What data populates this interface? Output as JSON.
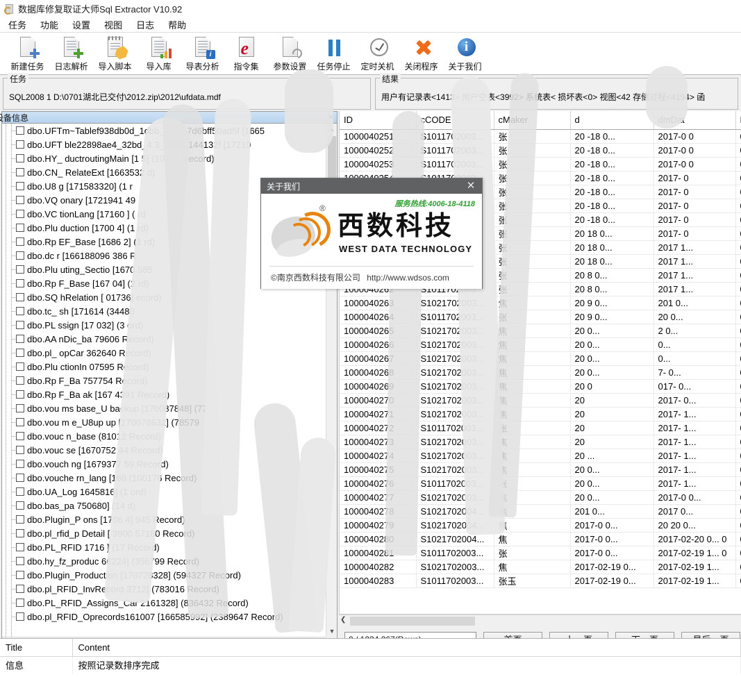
{
  "window": {
    "title": "数据库修复取证大师Sql Extractor V10.92",
    "app_icon": "database-repair-icon"
  },
  "menu": {
    "items": [
      "任务",
      "功能",
      "设置",
      "视图",
      "日志",
      "帮助"
    ]
  },
  "toolbar": {
    "buttons": [
      {
        "label": "新建任务",
        "icon": "new-task-icon"
      },
      {
        "label": "日志解析",
        "icon": "log-parse-icon"
      },
      {
        "label": "导入脚本",
        "icon": "import-script-icon"
      },
      {
        "label": "导入库",
        "icon": "import-db-icon"
      },
      {
        "label": "导表分析",
        "icon": "export-analysis-icon"
      },
      {
        "label": "指令集",
        "icon": "command-set-icon"
      },
      {
        "label": "参数设置",
        "icon": "parameter-settings-icon"
      },
      {
        "label": "任务停止",
        "icon": "stop-task-icon"
      },
      {
        "label": "定时关机",
        "icon": "scheduled-shutdown-icon"
      },
      {
        "label": "关闭程序",
        "icon": "close-program-icon"
      },
      {
        "label": "关于我们",
        "icon": "about-us-icon"
      }
    ]
  },
  "task_group": {
    "caption": "任务",
    "value": "SQL2008 1 D:\\0701湖北已交付\\2012.zip\\2012\\ufdata.mdf"
  },
  "result_group": {
    "caption": "结果",
    "value": "用户有记录表<1413>  用户空表<3992>  系统表<        损坏表<0>  视图<42        存储过程<4194>  函"
  },
  "left_pane": {
    "tab_label": "设备信息",
    "close_label": "×",
    "rows": [
      "dbo.UFTm~Tablef938db0d_1dbb_4                 20_7d6bff50ad5f [1665",
      "dbo.UFT        ble22898ae4_32bd_4         3_30011144132f [17210",
      "dbo.HY_        ductroutingMain [1        5] (10781 Record)",
      "dbo.CN_        RelateExt [1663532                  d)",
      "dbo.U8         g [171583320] (1                   r",
      "dbo.VQ         onary [1721941         49",
      "dbo.VC         tionLang [17160       ] (             rd",
      "dbo.Plu        duction [1700         4] (1          rd)",
      "dbo.Rp         EF_Base [1686         2] (1         rd)",
      "dbo.dc         r [166188096          386 R",
      "dbo.Plu        uting_Sectio       [1670          585",
      "dbo.Rp         F_Base [167        04] (2         rd)",
      "dbo.SQ         hRelation [       01736]         ecord)",
      "dbo.tc_        sh [171614         (34480",
      "dbo.PL         ssign [17         032] (3         ord)",
      "dbo.AA         nDic_ba          79606            Record)",
      "dbo.pl_        opCar          362640           Record)",
      "dbo.Plu        ctionIn         07595            Record)",
      "dbo.Rp         F_Ba          757754           Record)",
      "dbo.Rp         F_Ba      ak [167          4391 Record)",
      "dbo.vou        ms       base_U           backup [170087848] (77",
      "dbo.vou        m        e_U8up             up [170078632] (78579",
      "dbo.vouc               n_base               (81012 Record)",
      "dbo.vouc       se [1670752              44 Record)",
      "dbo.vouch              ng [1679377             59 Record)",
      "dbo.vouche             rn_lang [168            (100176 Record)",
      "dbo.UA_Log          1645816] (1             ord)",
      "dbo.bas_pa         750680] (14            d)",
      "dbo.Plugin_P         ons [1706        4]        945 Record)",
      "dbo.pl_rfid_p          Detail [       3900      57180 Record)",
      "dbo.PL_RFID            1716        ] (17      Record)",
      "dbo.hy_fz_produc              66224] (356799 Record)",
      "dbo.Plugin_Production          [170728328] (594327 Record)",
      "dbo.pl_RFID_InvRecord         3712] (783016 Record)",
      "dbo.PL_RFID_Assigns_Car      2161328] (836432 Record)",
      "dbo.pl_RFID_Oprecords161007 [166585992] (2389647 Record)"
    ]
  },
  "grid": {
    "columns": [
      "ID",
      "cCODE",
      "cMaker",
      "d",
      "dmDat",
      "FromType"
    ],
    "rows": [
      [
        "1000040251",
        "S1011702003...",
        "张",
        "20",
        "-18 0...",
        "2017-0",
        "0"
      ],
      [
        "1000040252",
        "S1011702003...",
        "张",
        "20",
        "-18 0...",
        "2017-0",
        "0"
      ],
      [
        "1000040253",
        "S1011702003...",
        "张",
        "20",
        "-18 0...",
        "2017-0",
        "0"
      ],
      [
        "1000040254",
        "S1011702003...",
        "张",
        "20",
        "-18 0...",
        "2017-",
        "0"
      ],
      [
        "1000040255",
        "S1011702003...",
        "张",
        "20",
        "-18 0...",
        "2017-",
        "0"
      ],
      [
        "1000040256",
        "S1011702003...",
        "张",
        "20",
        "-18 0...",
        "2017-",
        "0"
      ],
      [
        "1000040257",
        "S1011702003...",
        "张",
        "20",
        "-18 0...",
        "2017-",
        "0"
      ],
      [
        "1000040258",
        "S1011702003...",
        "张",
        "20",
        "18 0...",
        "2017-",
        "0"
      ],
      [
        "1000040259",
        "S1011702003...",
        "张",
        "20",
        "18 0...",
        "2017",
        "1...",
        "0"
      ],
      [
        "1000040260",
        "S1011702003...",
        "张",
        "20",
        "18 0...",
        "2017",
        "1...",
        "0"
      ],
      [
        "1000040261",
        "S1011702003...",
        "张",
        "20",
        "8 0...",
        "2017",
        "1...",
        "0"
      ],
      [
        "1000040262",
        "S1011702003...",
        "张",
        "20",
        "8 0...",
        "2017",
        "1...",
        "0"
      ],
      [
        "1000040263",
        "S1021702003...",
        "焦",
        "20",
        "9 0...",
        "201",
        "0...",
        "0"
      ],
      [
        "1000040264",
        "S1011702003...",
        "张",
        "20",
        "9 0...",
        "20",
        "0...",
        "0"
      ],
      [
        "1000040265",
        "S1021702003...",
        "焦",
        "20",
        "0...",
        "2",
        "0...",
        "0"
      ],
      [
        "1000040266",
        "S1021702003...",
        "焦",
        "20",
        "0...",
        "",
        "0...",
        "0"
      ],
      [
        "1000040267",
        "S1021702003...",
        "焦",
        "20",
        "0...",
        "",
        "0...",
        "0"
      ],
      [
        "1000040268",
        "S1021702003...",
        "焦",
        "20",
        "0...",
        "7-",
        "0...",
        "0"
      ],
      [
        "1000040269",
        "S1021702003...",
        "焦",
        "20",
        "0",
        "017-",
        "0...",
        "0"
      ],
      [
        "1000040270",
        "S1021702003...",
        "焦",
        "20",
        "",
        "2017-",
        "0...",
        "0"
      ],
      [
        "1000040271",
        "S1021702003...",
        "焦",
        "20",
        "",
        "2017-",
        "1...",
        "0"
      ],
      [
        "1000040272",
        "S1011702003...",
        "张",
        "20",
        "",
        "2017-",
        "1...",
        "0"
      ],
      [
        "1000040273",
        "S1021702003...",
        "焦",
        "20",
        "",
        "2017-",
        "1...",
        "0"
      ],
      [
        "1000040274",
        "S1021702003...",
        "焦",
        "20",
        "...",
        "2017-",
        "1...",
        "0"
      ],
      [
        "1000040275",
        "S1021702003...",
        "焦",
        "20",
        "0...",
        "2017-",
        "1...",
        "0"
      ],
      [
        "1000040276",
        "S1011702003...",
        "张",
        "20",
        "0...",
        "2017-",
        "1...",
        "0"
      ],
      [
        "1000040277",
        "S1021702003...",
        "焦",
        "20",
        "0...",
        "2017-0",
        "0...",
        "0"
      ],
      [
        "1000040278",
        "S1021702004...",
        "焦",
        "201",
        "0...",
        "2017",
        "0...",
        "0"
      ],
      [
        "1000040279",
        "S1021702004...",
        "焦",
        "2017-0",
        "0...",
        "20",
        "20 0...",
        "0"
      ],
      [
        "1000040280",
        "S1021702004...",
        "焦",
        "2017-0",
        "0...",
        "2017-02-20 0...",
        "0"
      ],
      [
        "1000040281",
        "S1011702003...",
        "张",
        "2017-0",
        "0...",
        "2017-02-19 1...",
        "0"
      ],
      [
        "1000040282",
        "S1021702003...",
        "焦",
        "2017-02-19 0...",
        "2017-02-19 1...",
        "0"
      ],
      [
        "1000040283",
        "S1011702003...",
        "张玉",
        "2017-02-19 0...",
        "2017-02-19 1...",
        "0"
      ]
    ]
  },
  "pager": {
    "count_text": "0 / 1234  267(Rows)",
    "first_label": "首页",
    "prev_label": "上一页",
    "next_label": "下一页",
    "last_label": "最后一页"
  },
  "log_pane": {
    "columns": [
      "Title",
      "Content"
    ],
    "rows": [
      [
        "信息",
        "按照记录数排序完成"
      ]
    ]
  },
  "about_dialog": {
    "title": "关于我们",
    "close_label": "✕",
    "hotline": "服务热线:4006-18-4118",
    "logo_cn": "西数科技",
    "logo_en": "WEST DATA TECHNOLOGY",
    "registered_mark": "®",
    "copyright": "©南京西数科技有限公司",
    "url": "http://www.wdsos.com"
  },
  "colors": {
    "accent_orange": "#e8830f",
    "hotline_green": "#2fa02f",
    "dialog_titlebar": "#5f6163",
    "tab_blue": "#b8d4ef",
    "info_blue": "#10459a",
    "close_orange": "#ef6c1a"
  }
}
